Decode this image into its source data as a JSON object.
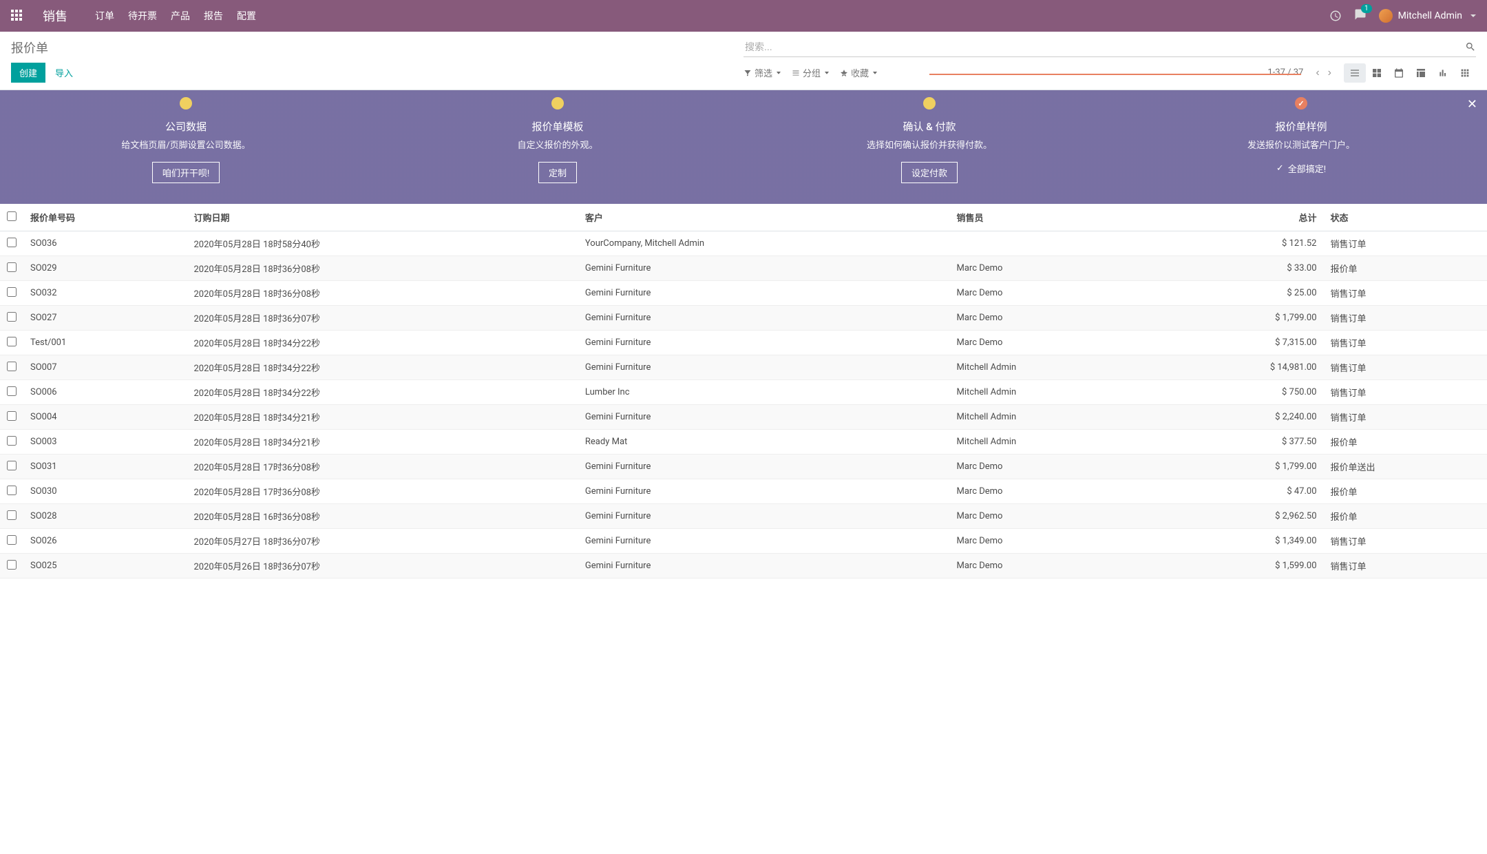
{
  "navbar": {
    "brand": "销售",
    "links": [
      "订单",
      "待开票",
      "产品",
      "报告",
      "配置"
    ],
    "chat_badge": "1",
    "user": "Mitchell Admin"
  },
  "control": {
    "breadcrumb": "报价单",
    "search_placeholder": "搜索...",
    "create": "创建",
    "import": "导入",
    "filter": "筛选",
    "group": "分组",
    "fav": "收藏",
    "pager": "1-37 / 37"
  },
  "onboarding": {
    "steps": [
      {
        "title": "公司数据",
        "desc": "给文档页眉/页脚设置公司数据。",
        "btn": "咱们开干呗!"
      },
      {
        "title": "报价单模板",
        "desc": "自定义报价的外观。",
        "btn": "定制"
      },
      {
        "title": "确认 & 付款",
        "desc": "选择如何确认报价并获得付款。",
        "btn": "设定付款"
      },
      {
        "title": "报价单样例",
        "desc": "发送报价以测试客户门户。",
        "done": "全部搞定!"
      }
    ]
  },
  "columns": {
    "number": "报价单号码",
    "date": "订购日期",
    "customer": "客户",
    "salesperson": "销售员",
    "total": "总计",
    "status": "状态"
  },
  "rows": [
    {
      "no": "SO036",
      "date": "2020年05月28日 18时58分40秒",
      "cust": "YourCompany, Mitchell Admin",
      "sp": "",
      "tot": "$ 121.52",
      "st": "销售订单"
    },
    {
      "no": "SO029",
      "date": "2020年05月28日 18时36分08秒",
      "cust": "Gemini Furniture",
      "sp": "Marc Demo",
      "tot": "$ 33.00",
      "st": "报价单"
    },
    {
      "no": "SO032",
      "date": "2020年05月28日 18时36分08秒",
      "cust": "Gemini Furniture",
      "sp": "Marc Demo",
      "tot": "$ 25.00",
      "st": "销售订单"
    },
    {
      "no": "SO027",
      "date": "2020年05月28日 18时36分07秒",
      "cust": "Gemini Furniture",
      "sp": "Marc Demo",
      "tot": "$ 1,799.00",
      "st": "销售订单"
    },
    {
      "no": "Test/001",
      "date": "2020年05月28日 18时34分22秒",
      "cust": "Gemini Furniture",
      "sp": "Marc Demo",
      "tot": "$ 7,315.00",
      "st": "销售订单"
    },
    {
      "no": "SO007",
      "date": "2020年05月28日 18时34分22秒",
      "cust": "Gemini Furniture",
      "sp": "Mitchell Admin",
      "tot": "$ 14,981.00",
      "st": "销售订单"
    },
    {
      "no": "SO006",
      "date": "2020年05月28日 18时34分22秒",
      "cust": "Lumber Inc",
      "sp": "Mitchell Admin",
      "tot": "$ 750.00",
      "st": "销售订单"
    },
    {
      "no": "SO004",
      "date": "2020年05月28日 18时34分21秒",
      "cust": "Gemini Furniture",
      "sp": "Mitchell Admin",
      "tot": "$ 2,240.00",
      "st": "销售订单"
    },
    {
      "no": "SO003",
      "date": "2020年05月28日 18时34分21秒",
      "cust": "Ready Mat",
      "sp": "Mitchell Admin",
      "tot": "$ 377.50",
      "st": "报价单"
    },
    {
      "no": "SO031",
      "date": "2020年05月28日 17时36分08秒",
      "cust": "Gemini Furniture",
      "sp": "Marc Demo",
      "tot": "$ 1,799.00",
      "st": "报价单送出"
    },
    {
      "no": "SO030",
      "date": "2020年05月28日 17时36分08秒",
      "cust": "Gemini Furniture",
      "sp": "Marc Demo",
      "tot": "$ 47.00",
      "st": "报价单"
    },
    {
      "no": "SO028",
      "date": "2020年05月28日 16时36分08秒",
      "cust": "Gemini Furniture",
      "sp": "Marc Demo",
      "tot": "$ 2,962.50",
      "st": "报价单"
    },
    {
      "no": "SO026",
      "date": "2020年05月27日 18时36分07秒",
      "cust": "Gemini Furniture",
      "sp": "Marc Demo",
      "tot": "$ 1,349.00",
      "st": "销售订单"
    },
    {
      "no": "SO025",
      "date": "2020年05月26日 18时36分07秒",
      "cust": "Gemini Furniture",
      "sp": "Marc Demo",
      "tot": "$ 1,599.00",
      "st": "销售订单"
    }
  ]
}
